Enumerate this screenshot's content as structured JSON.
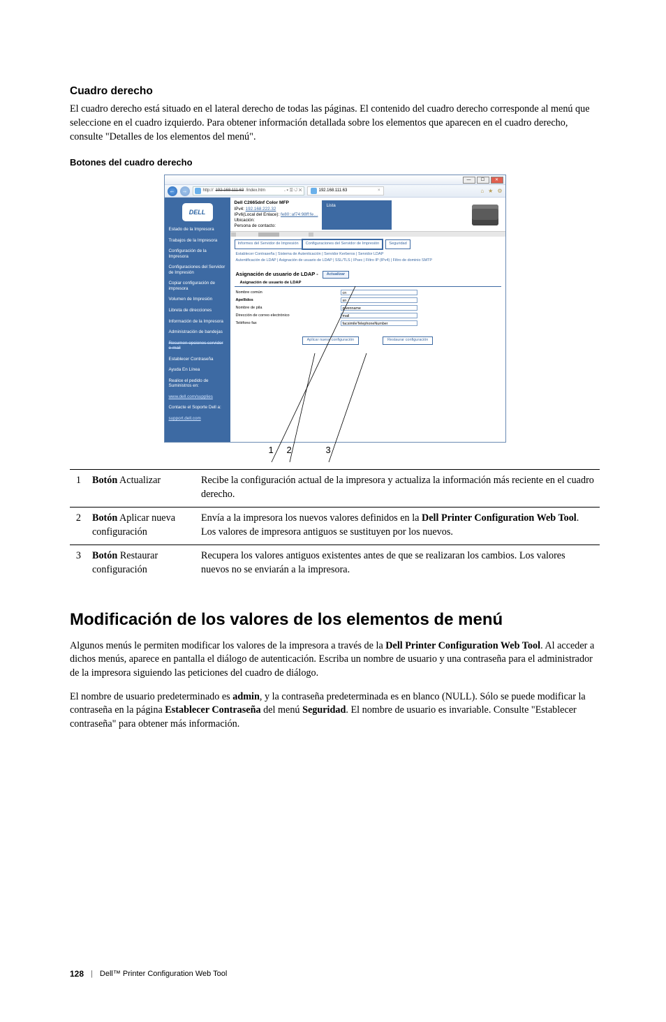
{
  "section": {
    "h2": "Cuadro derecho",
    "p1": "El cuadro derecho está situado en el lateral derecho de todas las páginas. El contenido del cuadro derecho corresponde al menú que seleccione en el cuadro izquierdo. Para obtener información detallada sobre los elementos que aparecen en el cuadro derecho, consulte \"Detalles de los elementos del menú\".",
    "h3": "Botones del cuadro derecho"
  },
  "screenshot": {
    "url_prefix": "http://",
    "url_mid": "/index.htm",
    "url_suffix": "𝆹 ▾ 🗟 ↺ ✕",
    "tab_label": "192.168.111.63",
    "tab_close": "×",
    "toolicons": [
      "⌂",
      "★",
      "⚙"
    ],
    "logo": "DELL",
    "sidebar": [
      "Estado de la Impresora",
      "Trabajos de la Impresora",
      "Configuración de la Impresora",
      "Configuraciones del Servidor de Impresión",
      "Copiar configuración de impresora",
      "Volumen de Impresión",
      "Libreta de direcciones",
      "Información de la Impresora",
      "Administración de bandejas",
      "Resumen opciones servidor e-mail",
      "Establecer Contraseña",
      "Ayuda En Línea",
      "Realice el pedido de Suministros en:",
      "www.dell.com/supplies",
      "Contacte el Soporte Dell a:",
      "support.dell.com"
    ],
    "info": {
      "model": "Dell C2665dnf Color MFP",
      "ipv4_label": "IPv4:",
      "ipv4": "192.168.222.32",
      "ipv6_label": "IPv6(Local del Enlace):",
      "ipv6": "fe80::af74:98ff:fe…",
      "loc_label": "Ubicación:",
      "contact_label": "Persona de contacto:"
    },
    "status_label": "Lista",
    "subtabs": {
      "a": "Informes del Servidor de Impresión",
      "b": "Configuraciones del Servidor de Impresión",
      "c": "Seguridad"
    },
    "crumbs1": "Establecer Contraseña | Sistema de Autenticación | Servidor Kerberos | Servidor LDAP",
    "crumbs2": "Autentificación de LDAP | Asignación de usuario de LDAP | SSL/TLS | IPsec | Filtro IP (IPv4) | Filtro de dominio SMTP",
    "pane_title": "Asignación de usuario de LDAP -",
    "refresh_btn": "Actualizar",
    "form_header": "Asignación de usuario de LDAP",
    "rows": [
      {
        "label": "Nombre común",
        "value": "cn",
        "bold": false
      },
      {
        "label": "Apellidos",
        "value": "sn",
        "bold": true
      },
      {
        "label": "Nombre de pila",
        "value": "givenname",
        "bold": false
      },
      {
        "label": "Dirección de correo electrónico",
        "value": "mail",
        "bold": false
      },
      {
        "label": "Teléfono fax",
        "value": "facsimileTelephoneNumber",
        "bold": false
      }
    ],
    "apply_btn": "Aplicar nueva configuración",
    "restore_btn": "Restaurar configuración",
    "callouts": [
      "1",
      "2",
      "3"
    ]
  },
  "table": {
    "rows": [
      {
        "num": "1",
        "name_prefix": "Botón",
        "name_rest": " Actualizar",
        "desc": "Recibe la configuración actual de la impresora y actualiza la información más reciente en el cuadro derecho."
      },
      {
        "num": "2",
        "name_prefix": "Botón",
        "name_rest": " Aplicar nueva configuración",
        "desc_a": "Envía a la impresora los nuevos valores definidos en la ",
        "desc_b": "Dell Printer Configuration Web Tool",
        "desc_c": ". Los valores de impresora antiguos se sustituyen por los nuevos."
      },
      {
        "num": "3",
        "name_prefix": "Botón",
        "name_rest": " Restaurar configuración",
        "desc": "Recupera los valores antiguos existentes antes de que se realizaran los cambios. Los valores nuevos no se enviarán a la impresora."
      }
    ]
  },
  "main": {
    "h1": "Modificación de los valores de los elementos de menú",
    "p1a": "Algunos menús le permiten modificar los valores de la impresora a través de la ",
    "p1b": "Dell Printer Configuration Web Tool",
    "p1c": ". Al acceder a dichos menús, aparece en pantalla el diálogo de autenticación. Escriba un nombre de usuario y una contraseña para el administrador de la impresora siguiendo las peticiones del cuadro de diálogo.",
    "p2a": "El nombre de usuario predeterminado es ",
    "p2b": "admin",
    "p2c": ", y la contraseña predeterminada es en blanco (NULL). Sólo se puede modificar la contraseña en la página ",
    "p2d": "Establecer Contraseña",
    "p2e": " del menú ",
    "p2f": "Seguridad",
    "p2g": ". El nombre de usuario es invariable. Consulte \"Establecer contraseña\" para obtener más información."
  },
  "footer": {
    "page": "128",
    "sep": "|",
    "title": "Dell™ Printer Configuration Web Tool"
  }
}
